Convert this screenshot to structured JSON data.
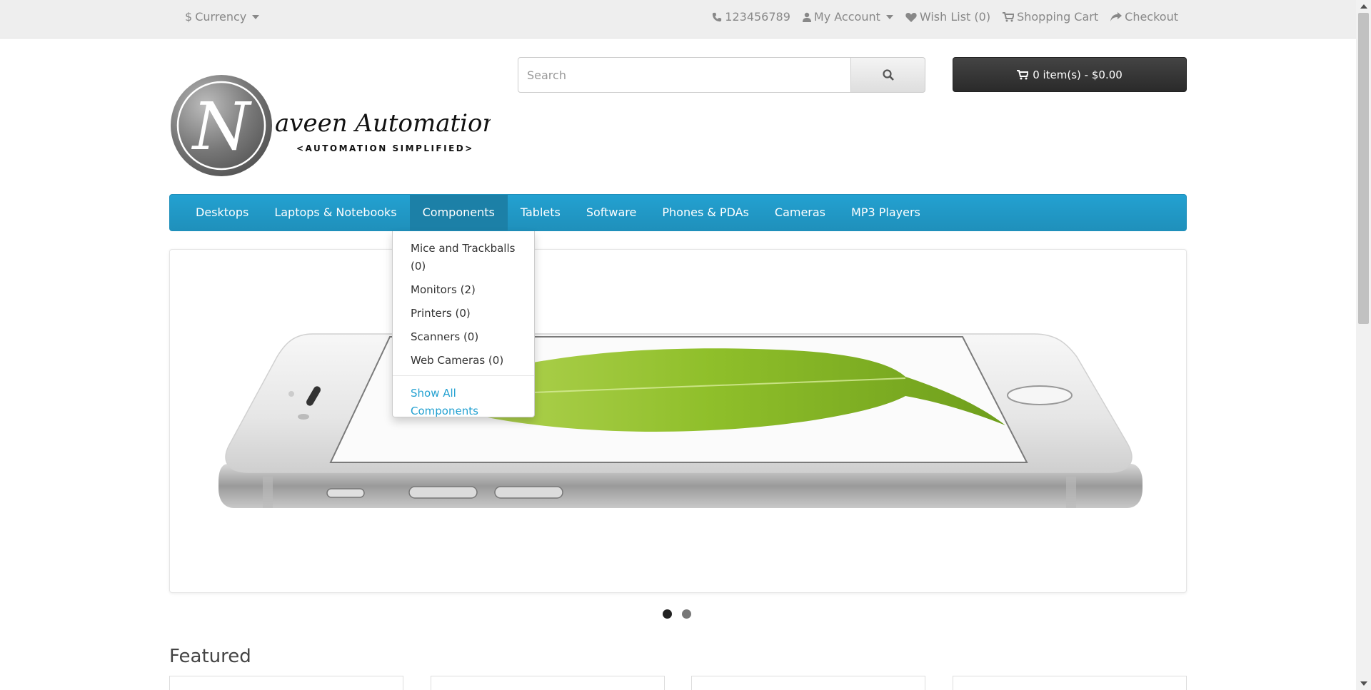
{
  "topbar": {
    "currency_symbol": "$",
    "currency_label": "Currency",
    "phone": "123456789",
    "my_account": "My Account",
    "wish_list": "Wish List (0)",
    "shopping_cart": "Shopping Cart",
    "checkout": "Checkout",
    "icons": [
      "phone-icon",
      "user-icon",
      "heart-icon",
      "cart-icon",
      "share-icon"
    ]
  },
  "logo": {
    "letter": "N",
    "name": "aveen Automation Labs",
    "tagline": "<AUTOMATION SIMPLIFIED>"
  },
  "search": {
    "placeholder": "Search",
    "button_icon": "search-icon"
  },
  "cart_button": {
    "icon": "cart-icon",
    "label": "0 item(s) - $0.00"
  },
  "menu": {
    "items": [
      "Desktops",
      "Laptops & Notebooks",
      "Components",
      "Tablets",
      "Software",
      "Phones & PDAs",
      "Cameras",
      "MP3 Players"
    ],
    "active_index": 2
  },
  "dropdown": {
    "items": [
      "Mice and Trackballs (0)",
      "Monitors (2)",
      "Printers (0)",
      "Scanners (0)",
      "Web Cameras (0)"
    ],
    "show_all": "Show All Components"
  },
  "slideshow": {
    "pager_count": 2,
    "active_index": 0
  },
  "section": {
    "featured_title": "Featured"
  },
  "colors": {
    "menu_blue": "#23a1d1",
    "link_blue": "#23a1d1",
    "cart_dark": "#333333",
    "topbar_bg": "#eeeeee"
  }
}
